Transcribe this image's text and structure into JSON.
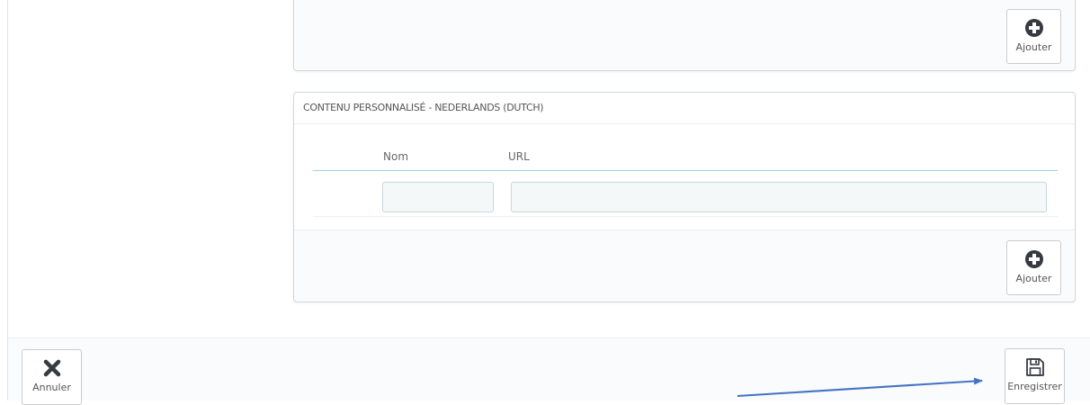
{
  "top_panel": {
    "add_button": {
      "label": "Ajouter",
      "icon": "plus-circle-icon"
    }
  },
  "dutch_panel": {
    "heading": "CONTENU PERSONNALISÉ - NEDERLANDS (DUTCH)",
    "table": {
      "columns": [
        "Nom",
        "URL"
      ],
      "rows": [
        {
          "nom": "",
          "url": ""
        }
      ]
    },
    "add_button": {
      "label": "Ajouter",
      "icon": "plus-circle-icon"
    }
  },
  "footer": {
    "cancel_button": {
      "label": "Annuler",
      "icon": "close-x-icon"
    },
    "save_button": {
      "label": "Enregistrer",
      "icon": "floppy-disk-icon"
    }
  },
  "annotation": {
    "arrow_color": "#4472c4"
  },
  "colors": {
    "border": "#d3d8db",
    "accent_line": "#9fd1e8",
    "input_bg": "#f5f8f9",
    "footer_bg": "#fafbfc",
    "icon": "#363a41"
  }
}
